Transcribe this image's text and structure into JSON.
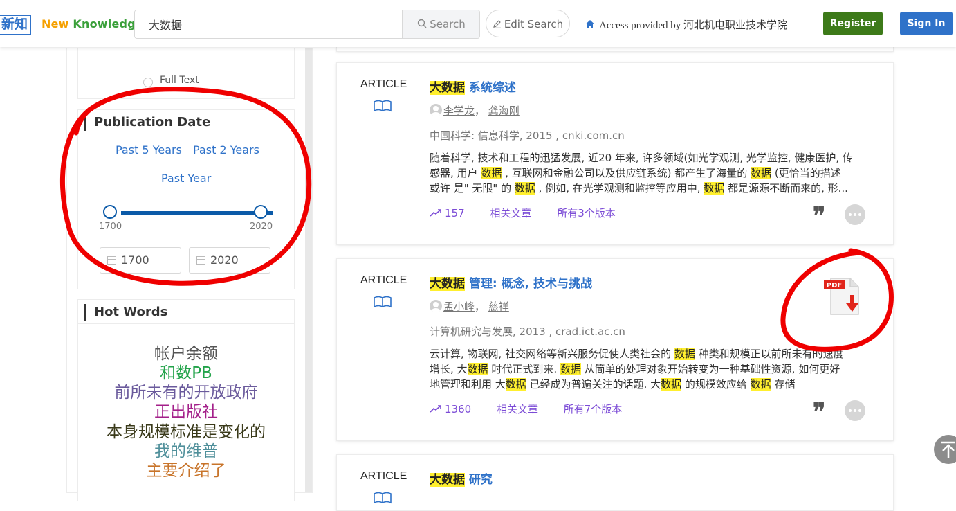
{
  "header": {
    "logo_cn": "新知",
    "logo_new": "New",
    "logo_knowledge": "Knowledge",
    "search_value": "大数据",
    "search_button": "Search",
    "edit_search": "Edit Search",
    "access_text": "Access provided by 河北机电职业技术学院",
    "register": "Register",
    "sign_in": "Sign In"
  },
  "sidebar": {
    "full_text": "Full Text",
    "publication_date": {
      "title": "Publication Date",
      "past5": "Past 5 Years",
      "past2": "Past 2 Years",
      "past1": "Past Year",
      "range_min": "1700",
      "range_max": "2020",
      "from_value": "1700",
      "to_value": "2020"
    },
    "hot_words": {
      "title": "Hot Words",
      "words": [
        "帐户余额",
        "和数PB",
        "前所未有的开放政府",
        "正出版社",
        "本身规模标准是变化的",
        "我的维普",
        "主要介绍了"
      ],
      "colors": [
        "#555555",
        "#22a34a",
        "#6a5a9c",
        "#a4208a",
        "#3a3a1a",
        "#4f8f9a",
        "#c8742a"
      ]
    }
  },
  "results": [
    {
      "type": "ARTICLE",
      "title_hl": "大数据",
      "title_rest": " 系统综述",
      "authors": [
        "李学龙",
        "龚海刚"
      ],
      "source": "中国科学: 信息科学, 2015 , cnki.com.cn",
      "abstract_lines": [
        [
          "随着科学, 技术和工程的迅猛发展, 近20 年来, 许多领域(如光学观测, 光学监控, 健康医护, 传"
        ],
        [
          "感器, 用户 ",
          "数据",
          " , 互联网和金融公司以及供应链系统) 都产生了海量的 ",
          "数据",
          " (更恰当的描述"
        ],
        [
          "或许 是\" 无限\" 的 ",
          "数据",
          " , 例如, 在光学观测和监控等应用中, ",
          "数据",
          " 都是源源不断而来的, 形..."
        ]
      ],
      "citations": "157",
      "related": "相关文章",
      "versions": "所有3个版本"
    },
    {
      "type": "ARTICLE",
      "title_hl": "大数据",
      "title_rest": " 管理: 概念, 技术与挑战",
      "authors": [
        "孟小峰",
        "慈祥"
      ],
      "source": "计算机研究与发展, 2013 , crad.ict.ac.cn",
      "abstract_lines": [
        [
          "云计算, 物联网, 社交网络等新兴服务促使人类社会的 ",
          "数据",
          " 种类和规模正以前所未有的速度"
        ],
        [
          "增长, 大",
          "数据",
          " 时代正式到来. ",
          "数据",
          " 从简单的处理对象开始转变为一种基础性资源, 如何更好"
        ],
        [
          "地管理和利用 大",
          "数据",
          " 已经成为普遍关注的话题. 大",
          "数据",
          " 的规模效应给 ",
          "数据",
          " 存储"
        ]
      ],
      "citations": "1360",
      "related": "相关文章",
      "versions": "所有7个版本",
      "pdf_label": "PDF"
    },
    {
      "type": "ARTICLE",
      "title_hl": "大数据",
      "title_rest": " 研究"
    }
  ]
}
